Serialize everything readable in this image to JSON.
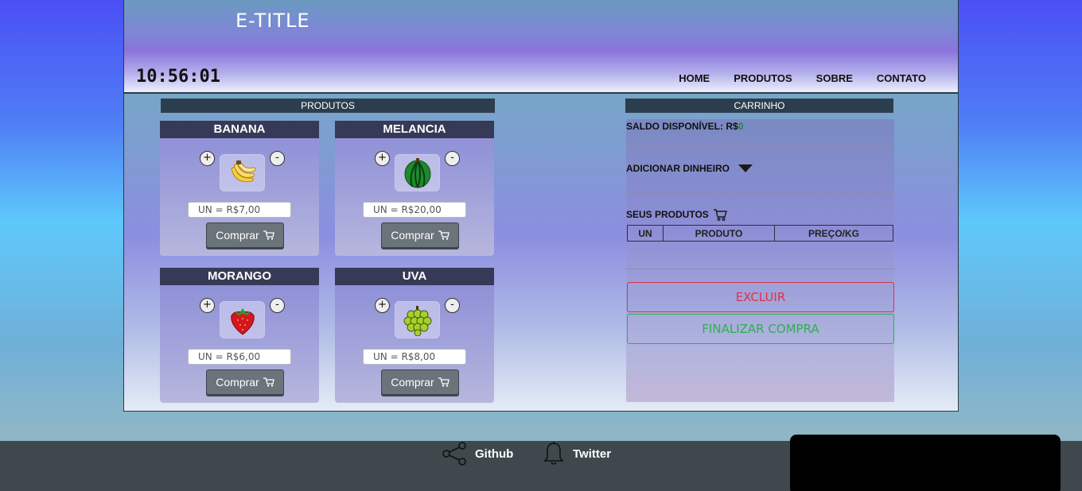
{
  "header": {
    "title": "E-TITLE",
    "clock": "10:56:01",
    "nav": [
      "HOME",
      "PRODUTOS",
      "SOBRE",
      "CONTATO"
    ]
  },
  "products": {
    "section_title": "PRODUTOS",
    "plus_label": "+",
    "minus_label": "-",
    "buy_label": "Comprar",
    "items": [
      {
        "name": "BANANA",
        "price": "UN = R$7,00",
        "icon": "banana-icon"
      },
      {
        "name": "MELANCIA",
        "price": "UN = R$20,00",
        "icon": "watermelon-icon"
      },
      {
        "name": "MORANGO",
        "price": "UN = R$6,00",
        "icon": "strawberry-icon"
      },
      {
        "name": "UVA",
        "price": "UN = R$8,00",
        "icon": "grapes-icon"
      }
    ]
  },
  "cart": {
    "section_title": "CARRINHO",
    "balance_label": "SALDO DISPONÍVEL: R$",
    "balance_value": "0",
    "add_money_label": "ADICIONAR DINHEIRO",
    "your_products_label": "SEUS PRODUTOS",
    "table_headers": [
      "UN",
      "PRODUTO",
      "PREÇO/KG"
    ],
    "delete_label": "EXCLUIR",
    "checkout_label": "FINALIZAR COMPRA",
    "colors": {
      "delete": "#e0304a",
      "checkout": "#2eae52",
      "balance": "#1a8a34"
    }
  },
  "footer": {
    "github_label": "Github",
    "twitter_label": "Twitter"
  }
}
